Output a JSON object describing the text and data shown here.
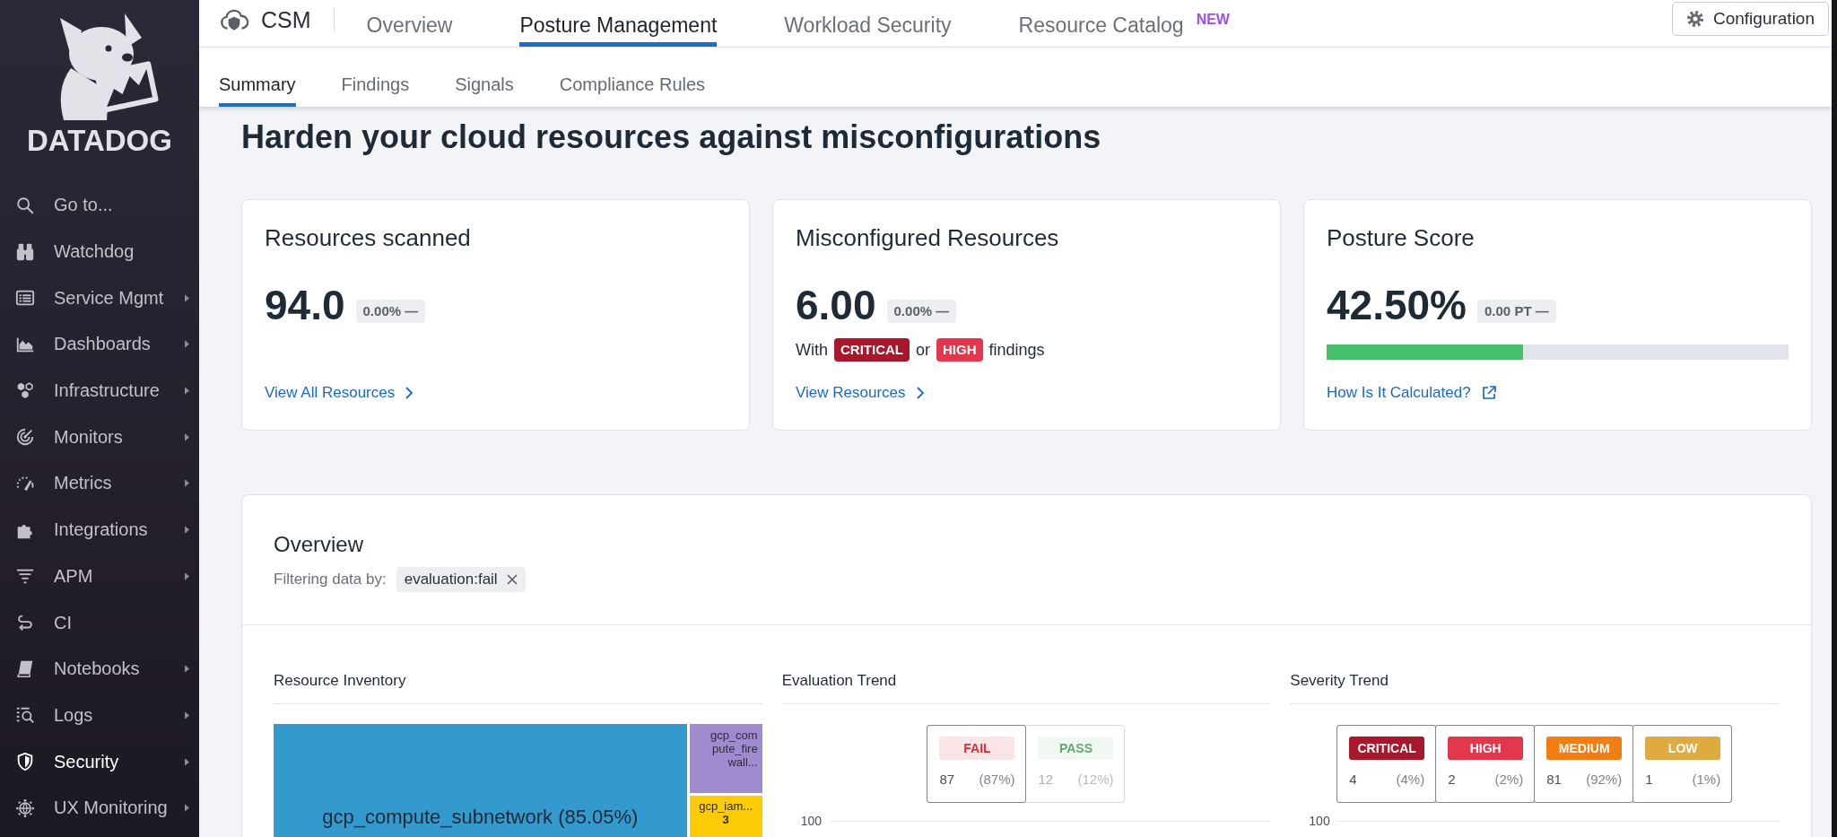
{
  "sidebar": {
    "logo_text": "DATADOG",
    "items": [
      {
        "label": "Go to...",
        "has_submenu": false,
        "selected": false
      },
      {
        "label": "Watchdog",
        "has_submenu": false,
        "selected": false
      },
      {
        "label": "Service Mgmt",
        "has_submenu": true,
        "selected": false
      },
      {
        "label": "Dashboards",
        "has_submenu": true,
        "selected": false
      },
      {
        "label": "Infrastructure",
        "has_submenu": true,
        "selected": false
      },
      {
        "label": "Monitors",
        "has_submenu": true,
        "selected": false
      },
      {
        "label": "Metrics",
        "has_submenu": true,
        "selected": false
      },
      {
        "label": "Integrations",
        "has_submenu": true,
        "selected": false
      },
      {
        "label": "APM",
        "has_submenu": true,
        "selected": false
      },
      {
        "label": "CI",
        "has_submenu": false,
        "selected": false
      },
      {
        "label": "Notebooks",
        "has_submenu": true,
        "selected": false
      },
      {
        "label": "Logs",
        "has_submenu": true,
        "selected": false
      },
      {
        "label": "Security",
        "has_submenu": true,
        "selected": true
      },
      {
        "label": "UX Monitoring",
        "has_submenu": true,
        "selected": false
      }
    ]
  },
  "top_nav": {
    "product": "CSM",
    "tabs": [
      {
        "label": "Overview",
        "selected": false
      },
      {
        "label": "Posture Management",
        "selected": true
      },
      {
        "label": "Workload Security",
        "selected": false
      },
      {
        "label": "Resource Catalog",
        "selected": false,
        "badge": "NEW"
      }
    ],
    "config_button": "Configuration"
  },
  "sub_nav": {
    "tabs": [
      {
        "label": "Summary",
        "selected": true
      },
      {
        "label": "Findings",
        "selected": false
      },
      {
        "label": "Signals",
        "selected": false
      },
      {
        "label": "Compliance Rules",
        "selected": false
      }
    ]
  },
  "heading": "Harden your cloud resources against misconfigurations",
  "cards": [
    {
      "title": "Resources scanned",
      "value": "94.0",
      "change": "0.00% —",
      "link": {
        "label": "View All Resources",
        "kind": "internal"
      }
    },
    {
      "title": "Misconfigured Resources",
      "value": "6.00",
      "change": "0.00% —",
      "note": [
        {
          "kind": "text",
          "text": "With"
        },
        {
          "kind": "tag",
          "text": "CRITICAL",
          "color": "#a8172b"
        },
        {
          "kind": "text",
          "text": "or"
        },
        {
          "kind": "tag",
          "text": "HIGH",
          "color": "#e3374d"
        },
        {
          "kind": "text",
          "text": "findings"
        }
      ],
      "link": {
        "label": "View Resources",
        "kind": "internal"
      }
    },
    {
      "title": "Posture Score",
      "value": "42.50%",
      "change": "0.00 PT —",
      "progress": {
        "level": 0.425
      },
      "link": {
        "label": "How Is It Calculated?",
        "kind": "external"
      }
    }
  ],
  "overview": {
    "title": "Overview",
    "filter_label": "Filtering data by:",
    "filters": [
      {
        "label": "evaluation:fail"
      }
    ],
    "panels": [
      {
        "title": "Resource Inventory",
        "kind": "treemap",
        "tiles": [
          {
            "label": "gcp_compute_subnetwork (85.05%)",
            "color": "#3499cd"
          },
          {
            "label": "gcp_compute_firewall...",
            "color": "#a08ad0"
          },
          {
            "label": "gcp_iam...",
            "count": "3",
            "color": "#fccb05"
          }
        ]
      },
      {
        "title": "Evaluation Trend",
        "kind": "evaluation",
        "legend": [
          {
            "label": "FAIL",
            "count": "87",
            "percent": "(87%)",
            "color": "#d8303f",
            "selected": true
          },
          {
            "label": "PASS",
            "count": "12",
            "percent": "(12%)",
            "color": "#62a870",
            "selected": false
          }
        ],
        "axis_label": "100"
      },
      {
        "title": "Severity Trend",
        "kind": "severity",
        "legend": [
          {
            "label": "CRITICAL",
            "count": "4",
            "percent": "(4%)",
            "color": "#a8172b",
            "selected": true
          },
          {
            "label": "HIGH",
            "count": "2",
            "percent": "(2%)",
            "color": "#e3374d",
            "selected": true
          },
          {
            "label": "MEDIUM",
            "count": "81",
            "percent": "(92%)",
            "color": "#f27d12",
            "selected": true
          },
          {
            "label": "LOW",
            "count": "1",
            "percent": "(1%)",
            "color": "#dfab41",
            "selected": true
          }
        ],
        "axis_label": "100"
      }
    ]
  }
}
